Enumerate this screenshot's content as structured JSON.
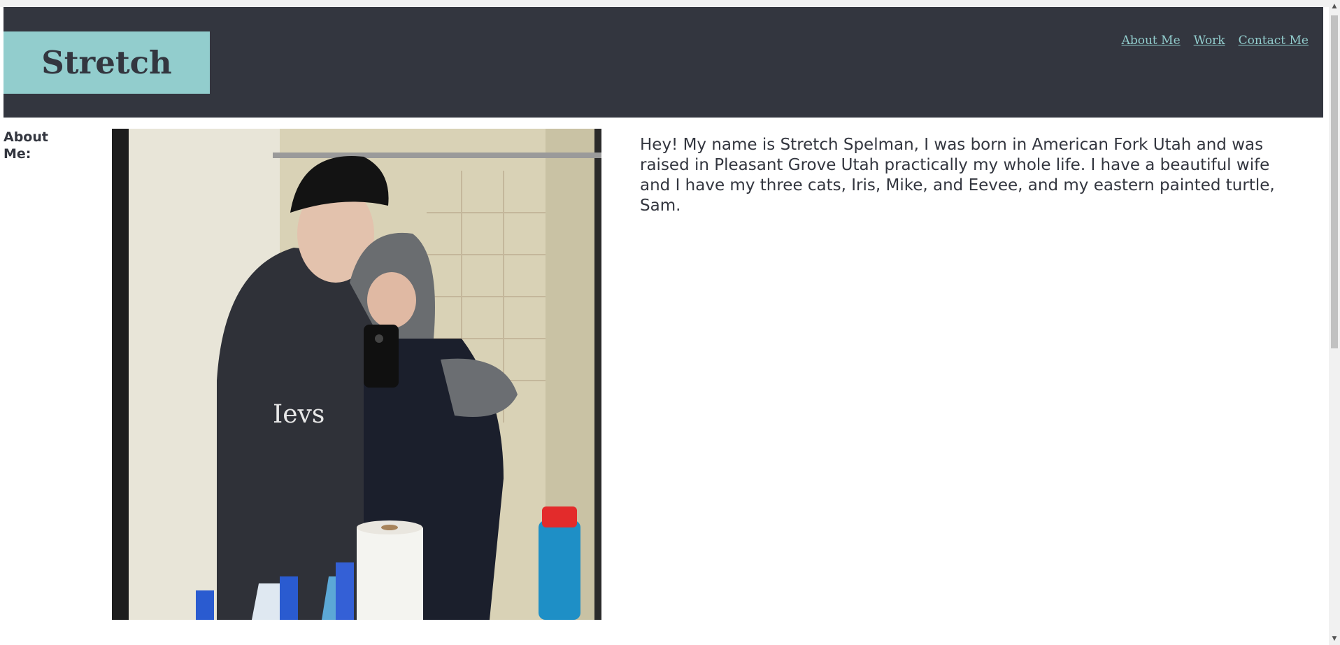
{
  "header": {
    "logo": "Stretch",
    "nav": [
      "About Me",
      "Work",
      "Contact Me"
    ]
  },
  "about": {
    "label": "About Me:",
    "photo_icon": "photo-couple-mirror-selfie",
    "bio": "Hey! My name is Stretch Spelman, I was born in American Fork Utah and was raised in Pleasant Grove Utah practically my whole life. I have a beautiful wife and I have my three cats, Iris, Mike, and Eevee, and my eastern painted turtle, Sam."
  },
  "colors": {
    "header_bg": "#33363f",
    "accent": "#92cdcd",
    "text": "#33363f"
  }
}
